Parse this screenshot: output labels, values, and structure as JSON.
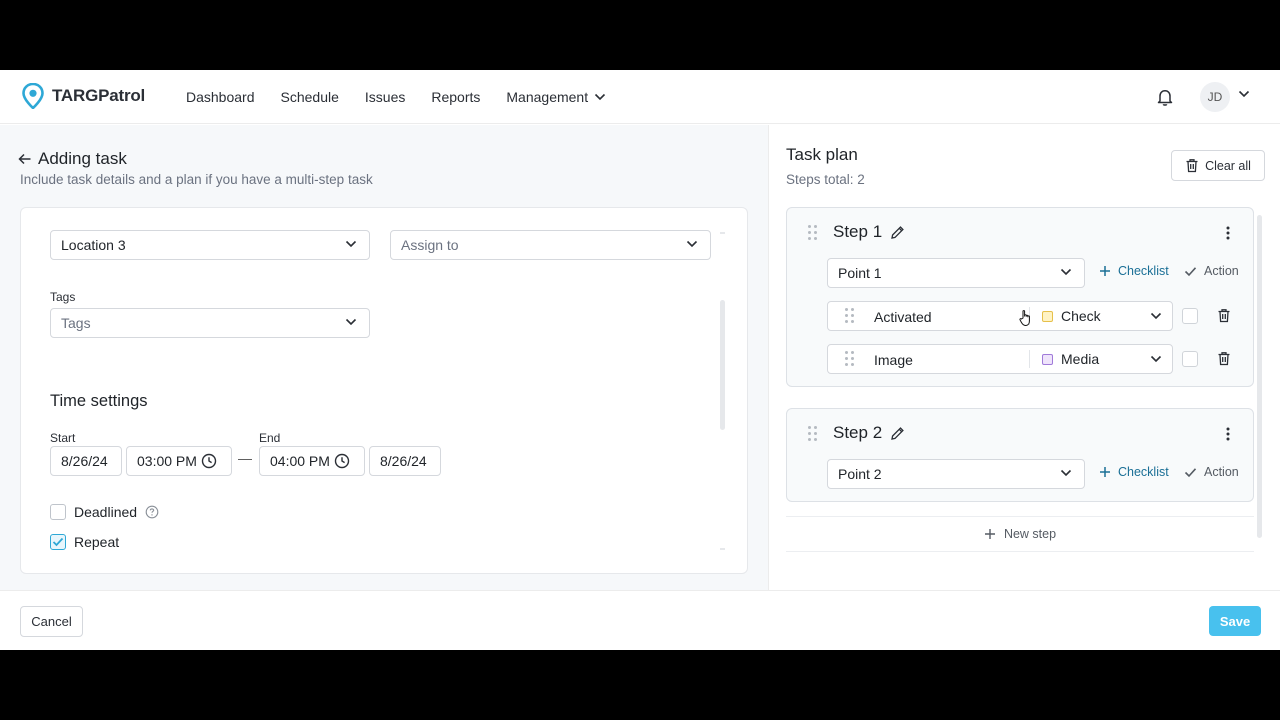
{
  "app": {
    "name": "TARGPatrol"
  },
  "nav": {
    "items": [
      "Dashboard",
      "Schedule",
      "Issues",
      "Reports",
      "Management"
    ],
    "user_initials": "JD"
  },
  "form": {
    "title": "Adding task",
    "subtitle": "Include task details and a plan if you have a multi-step task",
    "location_value": "Location 3",
    "assign_placeholder": "Assign to",
    "tags_label": "Tags",
    "tags_placeholder": "Tags",
    "time_settings_title": "Time settings",
    "start_label": "Start",
    "end_label": "End",
    "start_date": "8/26/24",
    "start_time": "03:00 PM",
    "end_time": "04:00 PM",
    "end_date": "8/26/24",
    "dash": "—",
    "deadlined_label": "Deadlined",
    "deadlined_checked": false,
    "repeat_label": "Repeat",
    "repeat_checked": true
  },
  "plan": {
    "title": "Task plan",
    "steps_total": "Steps total: 2",
    "clear_all": "Clear all",
    "checklist_label": "Checklist",
    "action_label": "Action",
    "new_step": "New step",
    "steps": [
      {
        "title": "Step 1",
        "point": "Point 1",
        "items": [
          {
            "name": "Activated",
            "type": "Check"
          },
          {
            "name": "Image",
            "type": "Media"
          }
        ]
      },
      {
        "title": "Step 2",
        "point": "Point 2",
        "items": []
      }
    ]
  },
  "footer": {
    "cancel": "Cancel",
    "save": "Save"
  },
  "colors": {
    "accent": "#48c1ee",
    "link": "#1a6f96",
    "logo": "#2ea8d6"
  },
  "icons": [
    "location-pin-icon",
    "chevron-down-icon",
    "bell-icon",
    "arrow-left-icon",
    "clock-icon",
    "help-circle-icon",
    "checkmark-icon",
    "trash-icon",
    "pencil-icon",
    "kebab-menu-icon",
    "drag-handle-icon",
    "plus-icon"
  ]
}
